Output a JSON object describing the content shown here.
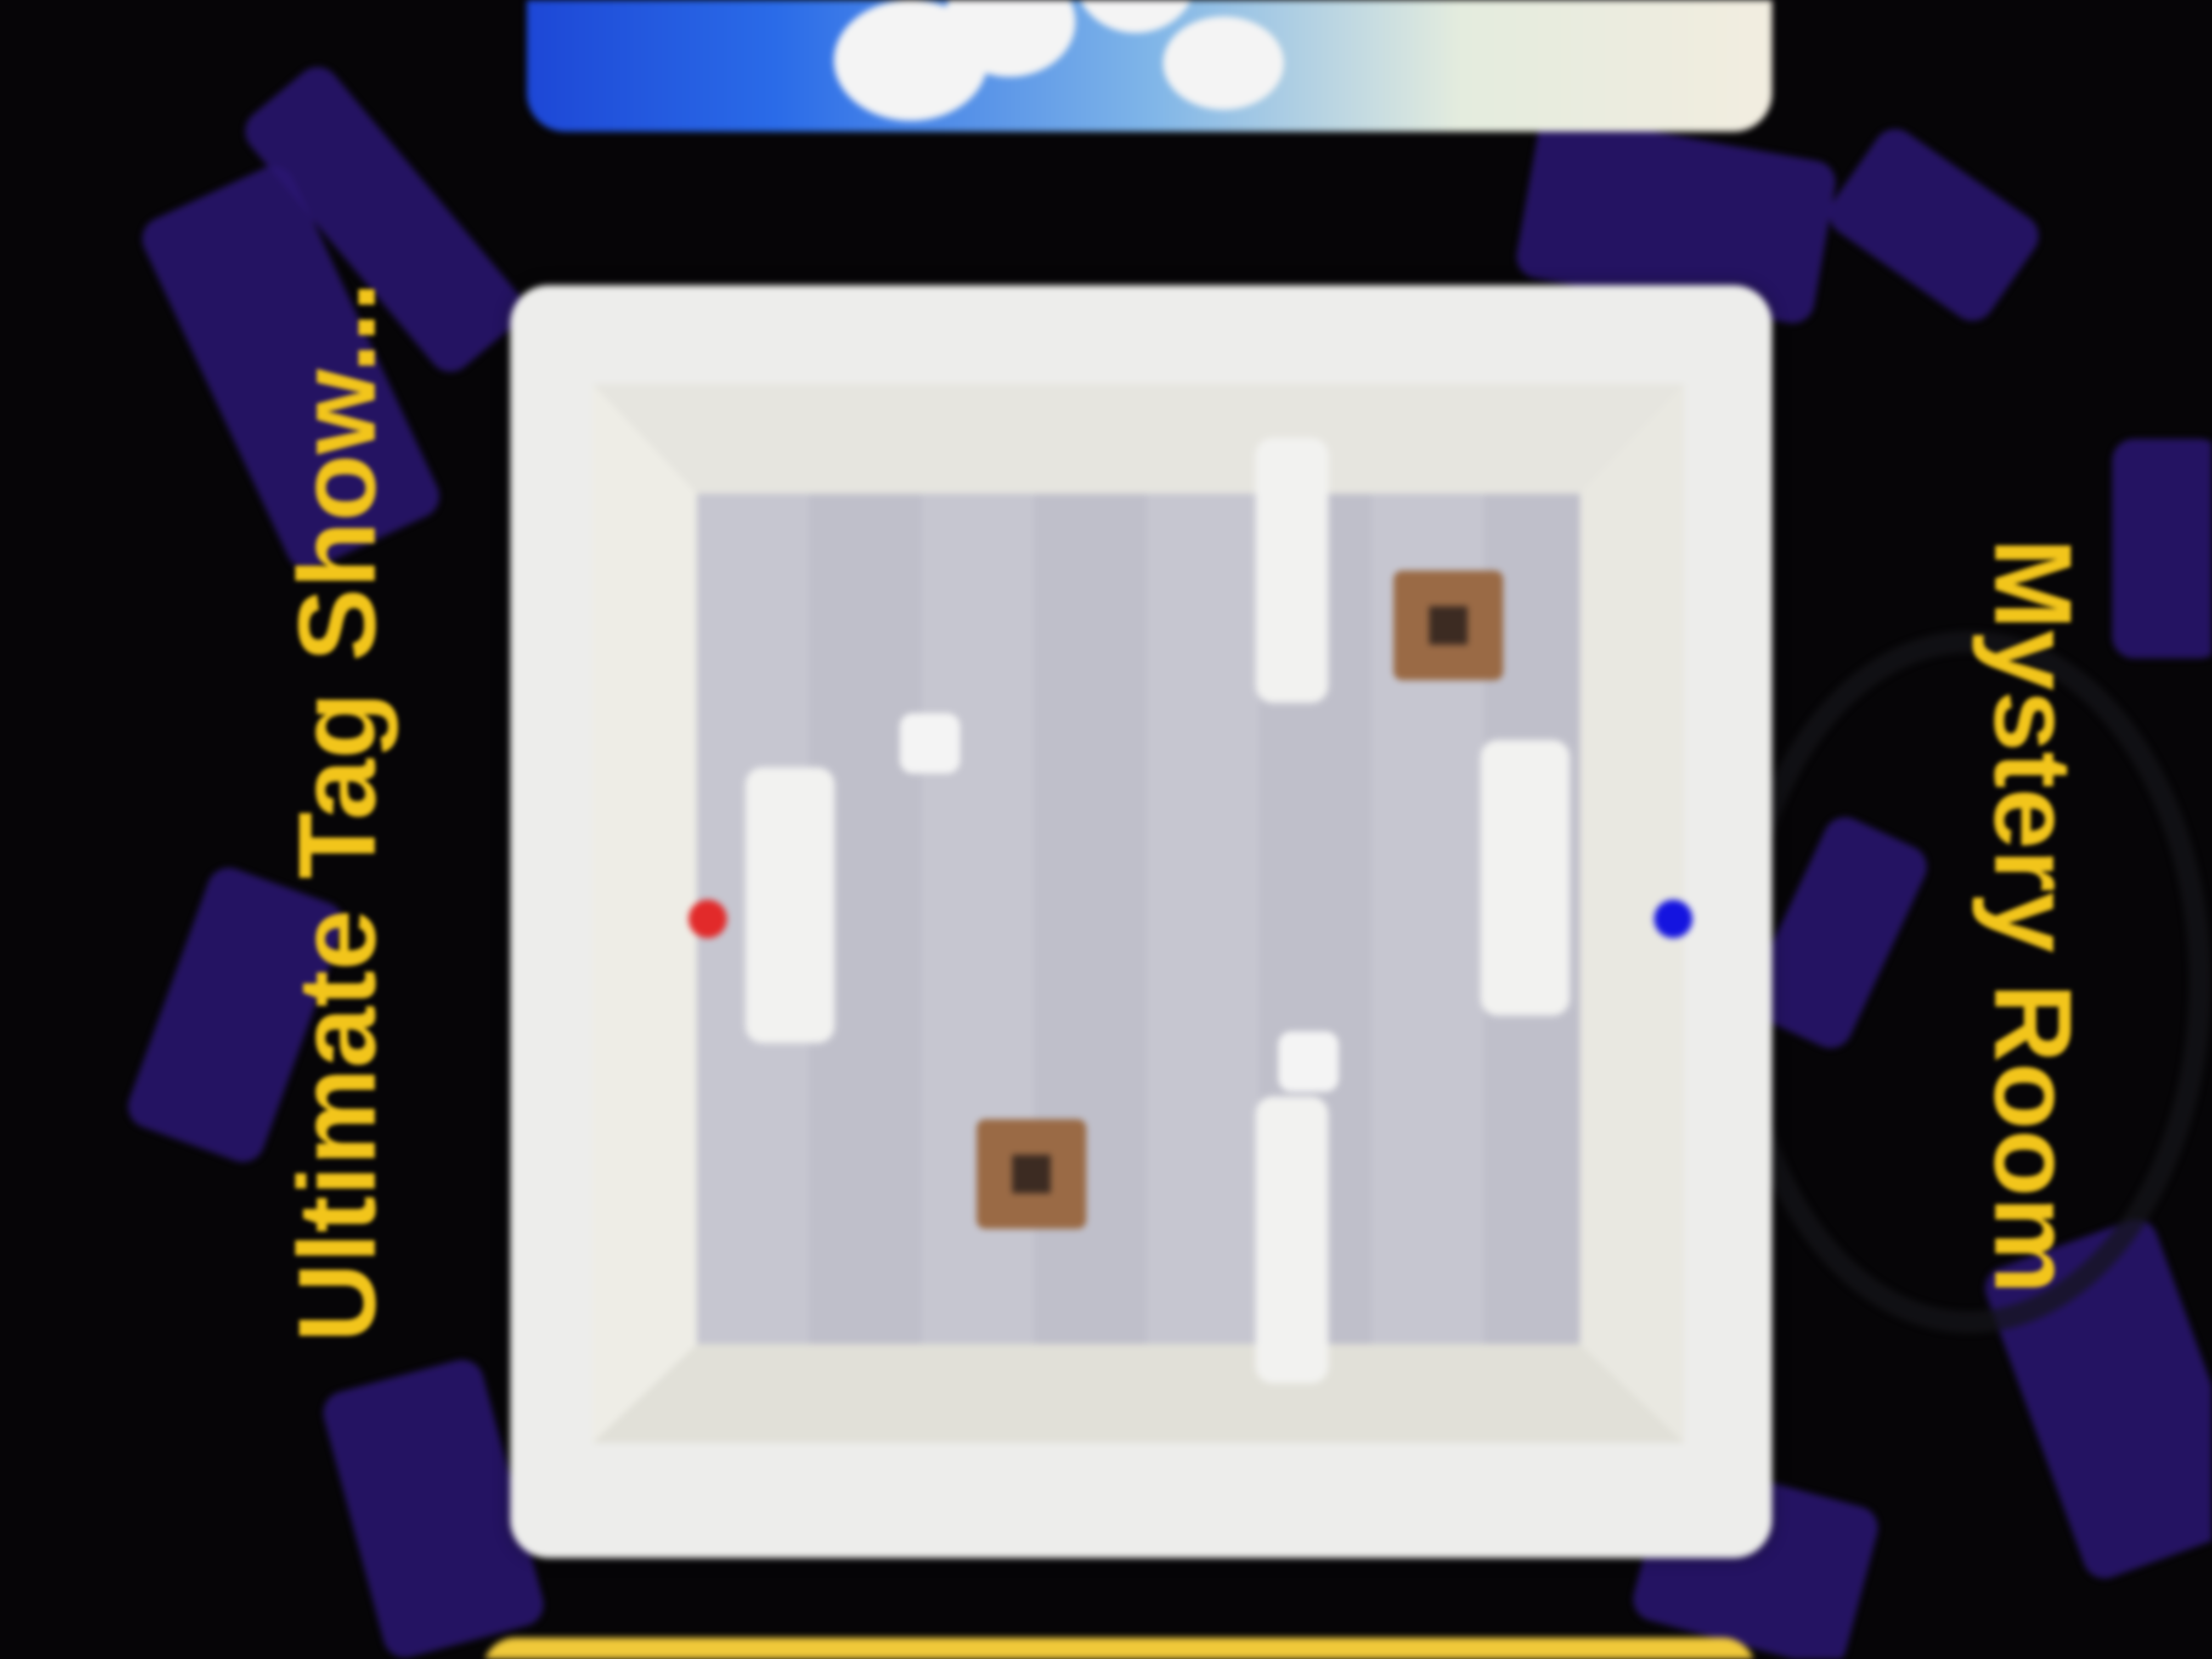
{
  "screen": {
    "background_color": "#060507",
    "accent_color": "#f2c51b",
    "decoration_color": "#2a1672"
  },
  "cards": [
    {
      "title": "Ultimate Tag Show...",
      "preview": {
        "description_icons": [
          "crate-icon",
          "crate-icon"
        ],
        "players": [
          {
            "team": "red",
            "color": "#e22a2a"
          },
          {
            "team": "blue",
            "color": "#1414e0"
          }
        ],
        "colors": {
          "frame": "#ededeb",
          "floor": "#c6c6d0",
          "wall": "#f2f2f0",
          "crate": "#9a6a45"
        }
      }
    },
    {
      "title": "Mystery Room"
    }
  ]
}
